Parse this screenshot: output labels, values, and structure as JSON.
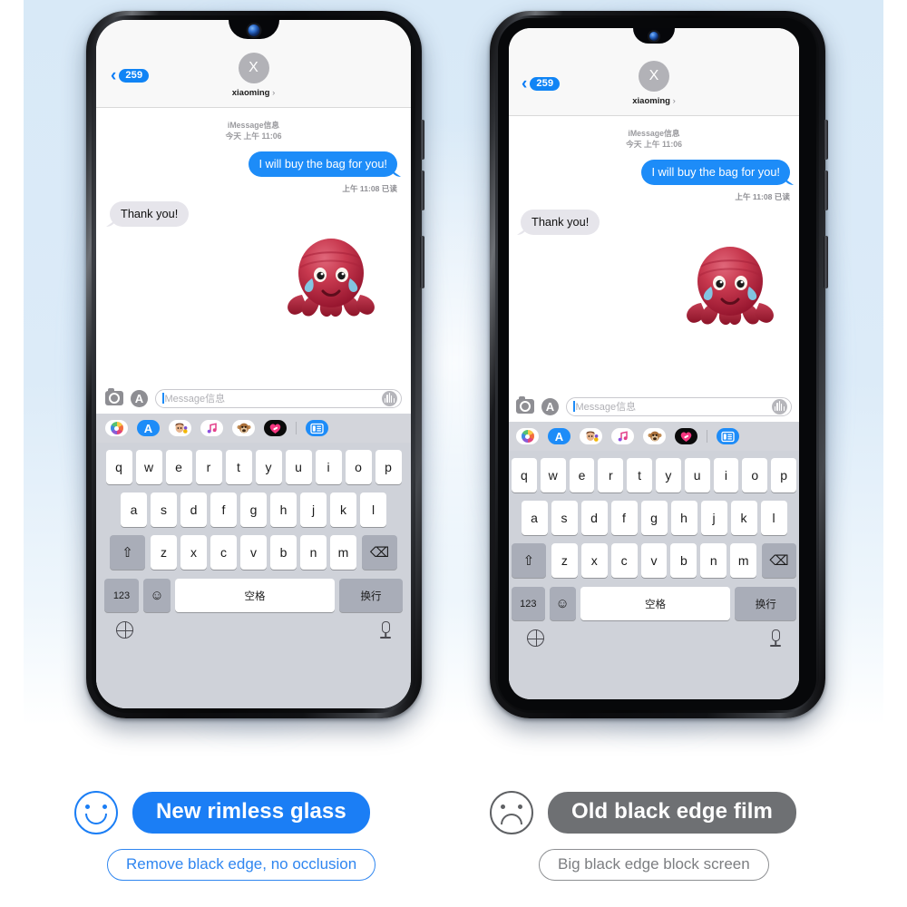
{
  "page": {
    "background_top_color": "#d8e9f7",
    "background_bottom_color": "#ffffff"
  },
  "phones": [
    {
      "id": "left",
      "variant": "new-rimless-glass",
      "bezel_style": "thin",
      "messaging": {
        "nav": {
          "back_badge": "259",
          "back_icon": "chevron-left-icon",
          "avatar_initial": "X",
          "contact_name": "xiaoming",
          "contact_chevron": "›"
        },
        "thread": {
          "service_label": "iMessage信息",
          "timestamp": "今天 上午 11:06",
          "outgoing_message": "I will buy the bag for you!",
          "read_receipt": "上午 11:08 已读",
          "incoming_message": "Thank you!",
          "sticker": "crying-octopus-memoji"
        },
        "input_bar": {
          "camera_icon": "camera-icon",
          "appstore_icon": "app-store-icon",
          "placeholder": "Message信息",
          "audio_icon": "audio-waveform-icon"
        },
        "app_row": [
          {
            "name": "photos-app-icon",
            "style": "white"
          },
          {
            "name": "app-store-app-icon",
            "style": "blue",
            "glyph": "A"
          },
          {
            "name": "memoji-girl-icon",
            "style": "white",
            "glyph": "👩"
          },
          {
            "name": "music-app-icon",
            "style": "white",
            "glyph": "♫"
          },
          {
            "name": "memoji-monkey-icon",
            "style": "white",
            "glyph": "🐵"
          },
          {
            "name": "digital-touch-icon",
            "style": "black",
            "glyph": "❤"
          },
          {
            "name": "app-drawer-icon",
            "style": "drawer",
            "glyph": "≣"
          }
        ],
        "keyboard": {
          "row1": [
            "q",
            "w",
            "e",
            "r",
            "t",
            "y",
            "u",
            "i",
            "o",
            "p"
          ],
          "row2": [
            "a",
            "s",
            "d",
            "f",
            "g",
            "h",
            "j",
            "k",
            "l"
          ],
          "row3": [
            "z",
            "x",
            "c",
            "v",
            "b",
            "n",
            "m"
          ],
          "shift_key": "⇧",
          "backspace_key": "⌫",
          "numbers_key": "123",
          "emoji_key": "☺",
          "space_key": "空格",
          "return_key": "换行",
          "globe_key": "globe-icon",
          "mic_key": "microphone-icon"
        }
      }
    },
    {
      "id": "right",
      "variant": "old-black-edge-film",
      "bezel_style": "thick",
      "messaging": {
        "nav": {
          "back_badge": "259",
          "back_icon": "chevron-left-icon",
          "avatar_initial": "X",
          "contact_name": "xiaoming",
          "contact_chevron": "›"
        },
        "thread": {
          "service_label": "iMessage信息",
          "timestamp": "今天 上午 11:06",
          "outgoing_message": "I will buy the bag for you!",
          "read_receipt": "上午 11:08 已读",
          "incoming_message": "Thank you!",
          "sticker": "crying-octopus-memoji"
        },
        "input_bar": {
          "camera_icon": "camera-icon",
          "appstore_icon": "app-store-icon",
          "placeholder": "Message信息",
          "audio_icon": "audio-waveform-icon"
        },
        "app_row": [
          {
            "name": "photos-app-icon",
            "style": "white"
          },
          {
            "name": "app-store-app-icon",
            "style": "blue",
            "glyph": "A"
          },
          {
            "name": "memoji-girl-icon",
            "style": "white",
            "glyph": "👩"
          },
          {
            "name": "music-app-icon",
            "style": "white",
            "glyph": "♫"
          },
          {
            "name": "memoji-monkey-icon",
            "style": "white",
            "glyph": "🐵"
          },
          {
            "name": "digital-touch-icon",
            "style": "black",
            "glyph": "❤"
          },
          {
            "name": "app-drawer-icon",
            "style": "drawer",
            "glyph": "≣"
          }
        ],
        "keyboard": {
          "row1": [
            "q",
            "w",
            "e",
            "r",
            "t",
            "y",
            "u",
            "i",
            "o",
            "p"
          ],
          "row2": [
            "a",
            "s",
            "d",
            "f",
            "g",
            "h",
            "j",
            "k",
            "l"
          ],
          "row3": [
            "z",
            "x",
            "c",
            "v",
            "b",
            "n",
            "m"
          ],
          "shift_key": "⇧",
          "backspace_key": "⌫",
          "numbers_key": "123",
          "emoji_key": "☺",
          "space_key": "空格",
          "return_key": "换行",
          "globe_key": "globe-icon",
          "mic_key": "microphone-icon"
        }
      }
    }
  ],
  "captions": {
    "left": {
      "face_icon": "smiley-face-icon",
      "headline": "New rimless glass",
      "subline": "Remove black edge, no occlusion",
      "color": "#1b7ef5"
    },
    "right": {
      "face_icon": "sad-face-icon",
      "headline": "Old black edge film",
      "subline": "Big black edge block screen",
      "color": "#6e7073"
    }
  }
}
